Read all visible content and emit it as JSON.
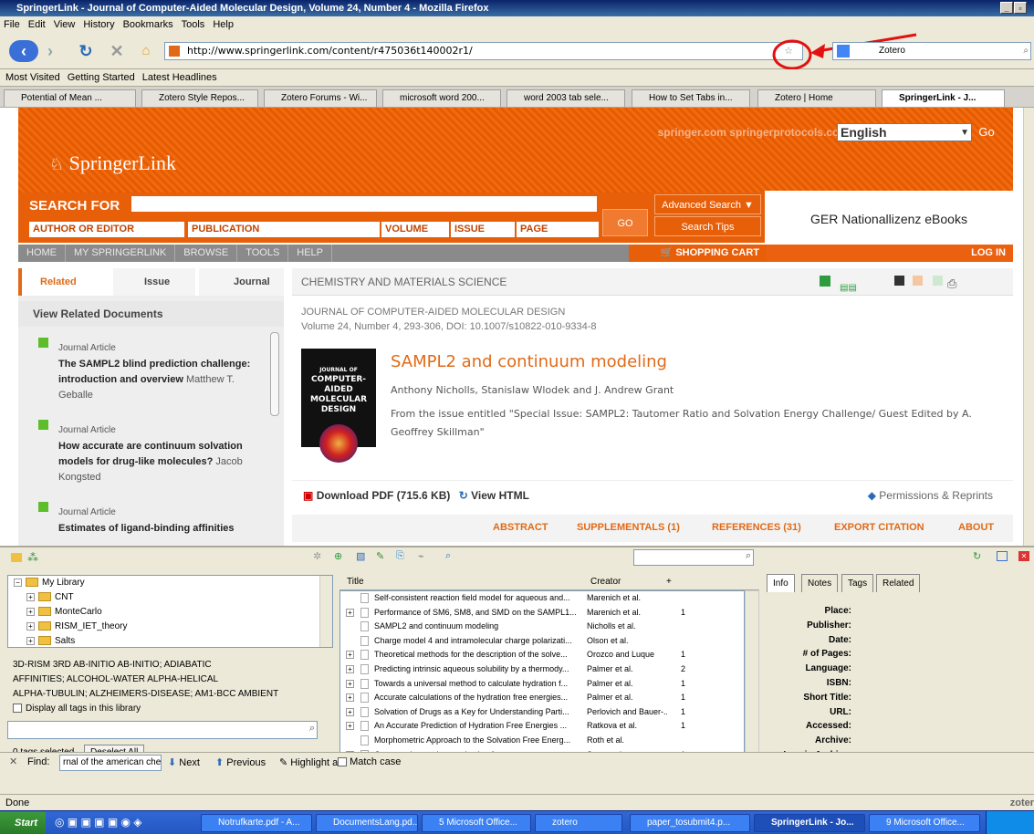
{
  "window": {
    "title": "SpringerLink - Journal of Computer-Aided Molecular Design, Volume 24, Number 4 - Mozilla Firefox"
  },
  "menu": [
    "File",
    "Edit",
    "View",
    "History",
    "Bookmarks",
    "Tools",
    "Help"
  ],
  "nav": {
    "url": "http://www.springerlink.com/content/r475036t140002r1/",
    "search_value": "Zotero"
  },
  "bookmarks": [
    "Most Visited",
    "Getting Started",
    "Latest Headlines"
  ],
  "tabs": [
    "Potential of Mean ...",
    "Zotero Style Repos...",
    "Zotero Forums - Wi...",
    "microsoft word 200...",
    "word 2003 tab sele...",
    "How to Set Tabs in...",
    "Zotero | Home",
    "SpringerLink - J..."
  ],
  "springer": {
    "top_links": "springer.com   springerprotocols.com",
    "language": "English",
    "go": "Go",
    "logo": "SpringerLink",
    "search_for": "SEARCH FOR",
    "fields": [
      "AUTHOR OR EDITOR",
      "PUBLICATION",
      "VOLUME",
      "ISSUE",
      "PAGE"
    ],
    "go_search": "GO",
    "advanced_search": "Advanced Search ▼",
    "search_tips": "Search Tips",
    "institution": "GER Nationallizenz eBooks",
    "nav_items": [
      "HOME",
      "MY SPRINGERLINK",
      "BROWSE",
      "TOOLS",
      "HELP"
    ],
    "cart": "🛒 SHOPPING CART",
    "login": "LOG IN",
    "side_tabs": [
      "Related",
      "Issue",
      "Journal"
    ],
    "view_related": "View Related Documents",
    "related": [
      {
        "type": "Journal Article",
        "title": "The SAMPL2 blind prediction challenge: introduction and overview",
        "author": "Matthew T. Geballe"
      },
      {
        "type": "Journal Article",
        "title": "How accurate are continuum solvation models for drug-like molecules?",
        "author": "Jacob Kongsted"
      },
      {
        "type": "Journal Article",
        "title": "Estimates of ligand-binding affinities",
        "author": ""
      }
    ],
    "section": "CHEMISTRY AND MATERIALS SCIENCE",
    "journal": "JOURNAL OF COMPUTER-AIDED MOLECULAR DESIGN",
    "volume_line": "Volume 24, Number 4, 293-306, DOI: 10.1007/s10822-010-9334-8",
    "cover_text": "COMPUTER-AIDED MOLECULAR DESIGN",
    "cover_small": "JOURNAL OF",
    "article_title": "SAMPL2 and continuum modeling",
    "authors": "Anthony Nicholls, Stanislaw Wlodek and J. Andrew Grant",
    "issue_text": "From the issue entitled \"Special Issue: SAMPL2: Tautomer Ratio and Solvation Energy Challenge/ Guest Edited by A. Geoffrey Skillman\"",
    "download": "Download PDF (715.6 KB)",
    "view_html": "View HTML",
    "permissions": "Permissions & Reprints",
    "article_nav": [
      "ABSTRACT",
      "SUPPLEMENTALS (1)",
      "REFERENCES (31)",
      "EXPORT CITATION",
      "ABOUT"
    ]
  },
  "zotero": {
    "collections": [
      {
        "name": "My Library",
        "expanded": true
      },
      {
        "name": "CNT"
      },
      {
        "name": "MonteCarlo"
      },
      {
        "name": "RISM_IET_theory"
      },
      {
        "name": "Salts"
      }
    ],
    "tags_line1": "3D-RISM   3RD   AB-INITIO   AB-INITIO;   ADIABATIC",
    "tags_line2": "AFFINITIES;   ALCOHOL-WATER   ALPHA-HELICAL",
    "tags_line3": "ALPHA-TUBULIN;   ALZHEIMERS-DISEASE;   AM1-BCC   AMBIENT",
    "display_all_tags": "Display all tags in this library",
    "tags_selected": "0 tags selected",
    "deselect_all": "Deselect All",
    "columns": {
      "title": "Title",
      "creator": "Creator",
      "plus": "+"
    },
    "items": [
      {
        "title": "Self-consistent reaction field model for aqueous and...",
        "creator": "Marenich et al.",
        "n": "",
        "plus": false
      },
      {
        "title": "Performance of SM6, SM8, and SMD on the SAMPL1...",
        "creator": "Marenich et al.",
        "n": "1",
        "plus": true
      },
      {
        "title": "SAMPL2 and continuum modeling",
        "creator": "Nicholls et al.",
        "n": "",
        "plus": false
      },
      {
        "title": "Charge model 4 and intramolecular charge polarizati...",
        "creator": "Olson et al.",
        "n": "",
        "plus": false
      },
      {
        "title": "Theoretical methods for the description of the solve...",
        "creator": "Orozco and Luque",
        "n": "1",
        "plus": true
      },
      {
        "title": "Predicting intrinsic aqueous solubility by a thermody...",
        "creator": "Palmer et al.",
        "n": "2",
        "plus": true
      },
      {
        "title": "Towards a universal method to calculate hydration f...",
        "creator": "Palmer et al.",
        "n": "1",
        "plus": true
      },
      {
        "title": "Accurate calculations of the hydration free energies...",
        "creator": "Palmer et al.",
        "n": "1",
        "plus": true
      },
      {
        "title": "Solvation of Drugs as a Key for Understanding Parti...",
        "creator": "Perlovich and Bauer-...",
        "n": "1",
        "plus": true
      },
      {
        "title": "An Accurate Prediction of Hydration Free Energies ...",
        "creator": "Ratkova et al.",
        "n": "1",
        "plus": true
      },
      {
        "title": "Morphometric Approach to the Solvation Free Energ...",
        "creator": "Roth et al.",
        "n": "",
        "plus": false
      },
      {
        "title": "Comparative study on solvation free energy expres...",
        "creator": "Sato et al.",
        "n": "1",
        "plus": true
      }
    ],
    "info_tabs": [
      "Info",
      "Notes",
      "Tags",
      "Related"
    ],
    "fields": [
      "Place:",
      "Publisher:",
      "Date:",
      "# of Pages:",
      "Language:",
      "ISBN:",
      "Short Title:",
      "URL:",
      "Accessed:",
      "Archive:",
      "Loc. in Archive:"
    ]
  },
  "find": {
    "label": "Find:",
    "value": "rnal of the american che",
    "next": "Next",
    "previous": "Previous",
    "highlight": "Highlight all",
    "match_case": "Match case"
  },
  "status": {
    "text": "Done",
    "right": "zoter"
  },
  "taskbar": {
    "start": "Start",
    "items": [
      "Notrufkarte.pdf - A...",
      "DocumentsLang.pd...",
      "5 Microsoft Office...",
      "zotero",
      "paper_tosubmit4.p...",
      "SpringerLink - Jo...",
      "9 Microsoft Office..."
    ]
  },
  "colors": {
    "springer_orange": "#e65a00",
    "title_orange": "#e06a18",
    "annotation_red": "#e31010"
  }
}
